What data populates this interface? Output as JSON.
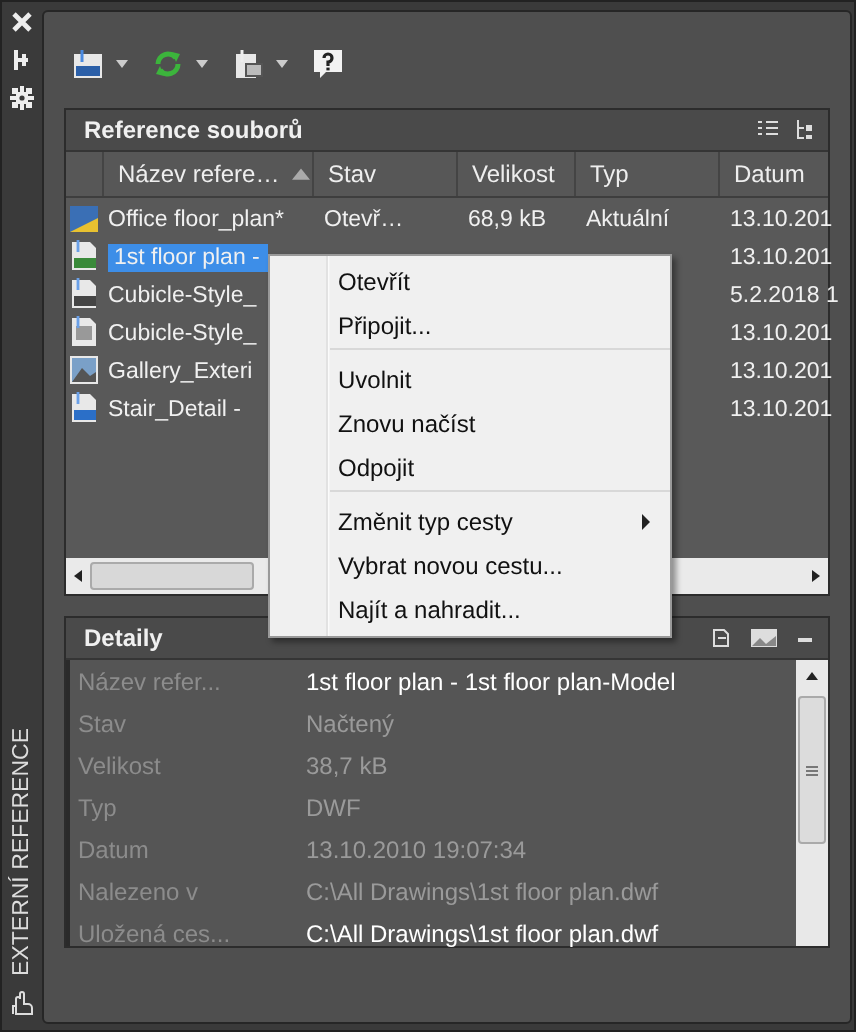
{
  "sidebar": {
    "title": "EXTERNÍ REFERENCE"
  },
  "panel": {
    "title": "Reference souborů",
    "columns": [
      {
        "label": "Název refere…",
        "sorted": true
      },
      {
        "label": "Stav",
        "sorted": false
      },
      {
        "label": "Velikost",
        "sorted": false
      },
      {
        "label": "Typ",
        "sorted": false
      },
      {
        "label": "Datum",
        "sorted": false
      }
    ],
    "rows": [
      {
        "kind": "drawing",
        "selected": false,
        "cells": [
          "Office floor_plan*",
          "Otevř…",
          "68,9 kB",
          "Aktuální",
          "13.10.201"
        ]
      },
      {
        "kind": "dwf",
        "selected": true,
        "cells": [
          "1st floor plan -",
          "",
          "",
          "",
          "13.10.201"
        ]
      },
      {
        "kind": "dwg",
        "selected": false,
        "cells": [
          "Cubicle-Style_",
          "",
          "",
          "",
          "5.2.2018 1"
        ]
      },
      {
        "kind": "page",
        "selected": false,
        "cells": [
          "Cubicle-Style_",
          "",
          "",
          "",
          "13.10.201"
        ]
      },
      {
        "kind": "image",
        "selected": false,
        "cells": [
          "Gallery_Exteri",
          "",
          "",
          "",
          "13.10.201"
        ]
      },
      {
        "kind": "dgn",
        "selected": false,
        "cells": [
          "Stair_Detail -",
          "",
          "",
          "",
          "13.10.201"
        ]
      }
    ]
  },
  "menu": {
    "groups": [
      [
        {
          "label": "Otevřít",
          "submenu": false
        },
        {
          "label": "Připojit...",
          "submenu": false
        }
      ],
      [
        {
          "label": "Uvolnit",
          "submenu": false
        },
        {
          "label": "Znovu načíst",
          "submenu": false
        },
        {
          "label": "Odpojit",
          "submenu": false
        }
      ],
      [
        {
          "label": "Změnit typ cesty",
          "submenu": true
        },
        {
          "label": "Vybrat novou cestu...",
          "submenu": false
        },
        {
          "label": "Najít a nahradit...",
          "submenu": false
        }
      ]
    ]
  },
  "details": {
    "title": "Detaily",
    "rows": [
      {
        "label": "Název refer...",
        "value": "1st floor plan - 1st floor plan-Model",
        "editable": true
      },
      {
        "label": "Stav",
        "value": "Načtený",
        "editable": false
      },
      {
        "label": "Velikost",
        "value": "38,7 kB",
        "editable": false
      },
      {
        "label": "Typ",
        "value": "DWF",
        "editable": false
      },
      {
        "label": "Datum",
        "value": "13.10.2010 19:07:34",
        "editable": false
      },
      {
        "label": "Nalezeno v",
        "value": "C:\\All Drawings\\1st floor plan.dwf",
        "editable": false
      },
      {
        "label": "Uložená ces...",
        "value": "C:\\All Drawings\\1st floor plan.dwf",
        "editable": true
      }
    ]
  }
}
